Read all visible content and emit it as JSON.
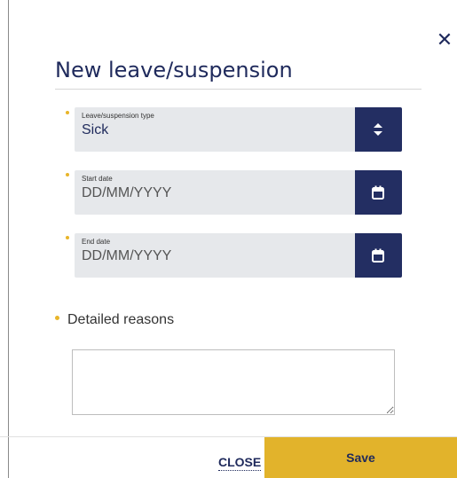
{
  "dialog": {
    "title": "New leave/suspension",
    "close_icon_glyph": "✕",
    "icons": {
      "close": "close-icon",
      "select": "sort-arrows-icon",
      "calendar": "calendar-icon"
    }
  },
  "form": {
    "type_field": {
      "label": "Leave/suspension type",
      "value": "Sick",
      "required": true
    },
    "start_date": {
      "label": "Start date",
      "placeholder": "DD/MM/YYYY",
      "required": true
    },
    "end_date": {
      "label": "End date",
      "placeholder": "DD/MM/YYYY",
      "required": true
    },
    "reasons": {
      "label": "Detailed reasons",
      "value": "",
      "required": true
    }
  },
  "footer": {
    "close_label": "CLOSE",
    "save_label": "Save"
  },
  "colors": {
    "brand_navy": "#232e62",
    "accent_yellow": "#e2b32b",
    "field_background": "#e6e8eb"
  }
}
